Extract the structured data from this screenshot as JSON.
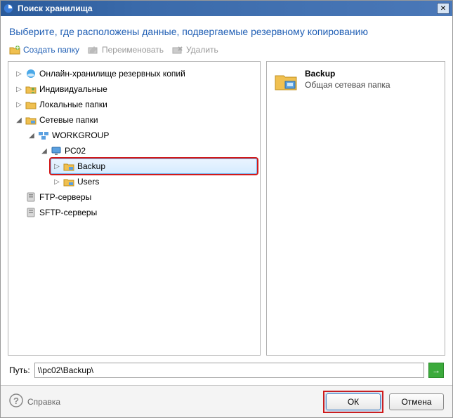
{
  "window": {
    "title": "Поиск хранилища",
    "close_glyph": "✕"
  },
  "header": "Выберите, где расположены данные, подвергаемые резервному копированию",
  "toolbar": {
    "create": "Создать папку",
    "rename": "Переименовать",
    "delete": "Удалить"
  },
  "tree": {
    "online": "Онлайн-хранилище резервных копий",
    "individual": "Индивидуальные",
    "local": "Локальные папки",
    "network": "Сетевые папки",
    "workgroup": "WORKGROUP",
    "pc": "PC02",
    "backup": "Backup",
    "users": "Users",
    "ftp": "FTP-серверы",
    "sftp": "SFTP-серверы"
  },
  "detail": {
    "title": "Backup",
    "subtitle": "Общая сетевая папка"
  },
  "path": {
    "label": "Путь:",
    "value": "\\\\pc02\\Backup\\",
    "go_glyph": "→"
  },
  "footer": {
    "help": "Справка",
    "ok": "ОК",
    "cancel": "Отмена"
  },
  "glyphs": {
    "collapsed": "▷",
    "expanded": "◢"
  }
}
